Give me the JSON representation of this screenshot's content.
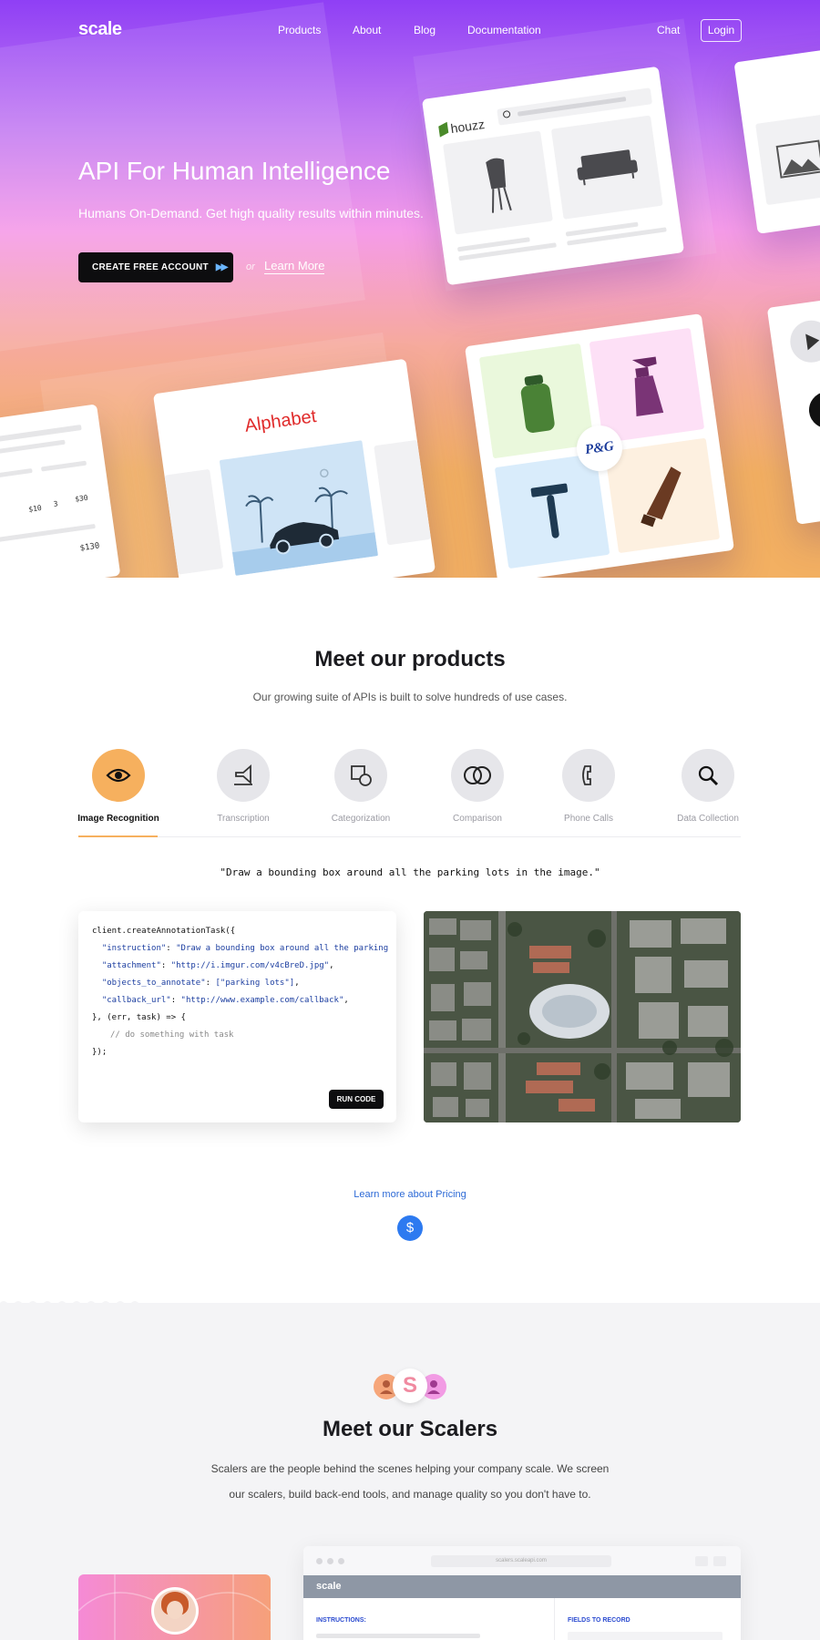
{
  "nav": {
    "logo": "scale",
    "links": [
      "Products",
      "About",
      "Blog",
      "Documentation"
    ],
    "chat": "Chat",
    "login": "Login"
  },
  "hero": {
    "title": "API For Human Intelligence",
    "subtitle": "Humans On-Demand. Get high quality results within minutes.",
    "cta": "CREATE FREE ACCOUNT",
    "or": "or",
    "learn_more": "Learn More",
    "cards": {
      "houzz": "houzz",
      "alphabet": "Alphabet",
      "pg": "P&G",
      "price_1": "$10",
      "price_2": "3",
      "price_3": "$30",
      "price_total": "$130"
    }
  },
  "products": {
    "title": "Meet our products",
    "subtitle": "Our growing suite of APIs is built to solve hundreds of use cases.",
    "tabs": [
      {
        "label": "Image Recognition",
        "icon": "eye-icon"
      },
      {
        "label": "Transcription",
        "icon": "megaphone-icon"
      },
      {
        "label": "Categorization",
        "icon": "shapes-icon"
      },
      {
        "label": "Comparison",
        "icon": "overlap-circles-icon"
      },
      {
        "label": "Phone Calls",
        "icon": "phone-icon"
      },
      {
        "label": "Data Collection",
        "icon": "magnifier-icon"
      }
    ],
    "active_tab": "Image Recognition",
    "quote": "\"Draw a bounding box around all the parking lots in the image.\"",
    "code": {
      "l1": "client.createAnnotationTask({",
      "l2_key": "\"instruction\"",
      "l2_val": "\"Draw a bounding box around all the parking",
      "l3_key": "\"attachment\"",
      "l3_val": "\"http://i.imgur.com/v4cBreD.jpg\"",
      "l4_key": "\"objects_to_annotate\"",
      "l4_val": "[\"parking lots\"]",
      "l5_key": "\"callback_url\"",
      "l5_val": "\"http://www.example.com/callback\"",
      "l6": "}, (err, task) => {",
      "l7": "// do something with task",
      "l8": "});"
    },
    "run_code": "RUN CODE",
    "pricing_link": "Learn more about Pricing",
    "pricing_icon": "$"
  },
  "scalers": {
    "title": "Meet our Scalers",
    "badge_letter": "S",
    "para_1": "Scalers are the people behind the scenes helping your company scale. We screen",
    "para_2": "our scalers, build back-end tools, and manage quality so you don't have to.",
    "browser_url": "scalers.scaleapi.com",
    "app_logo": "scale",
    "instructions_label": "INSTRUCTIONS:",
    "fields_label": "FIELDS TO RECORD"
  },
  "colors": {
    "accent_orange": "#f6b05e",
    "link_blue": "#2d6ad6",
    "hero_purple": "#8f3ff5",
    "hero_orange": "#f3b062"
  }
}
